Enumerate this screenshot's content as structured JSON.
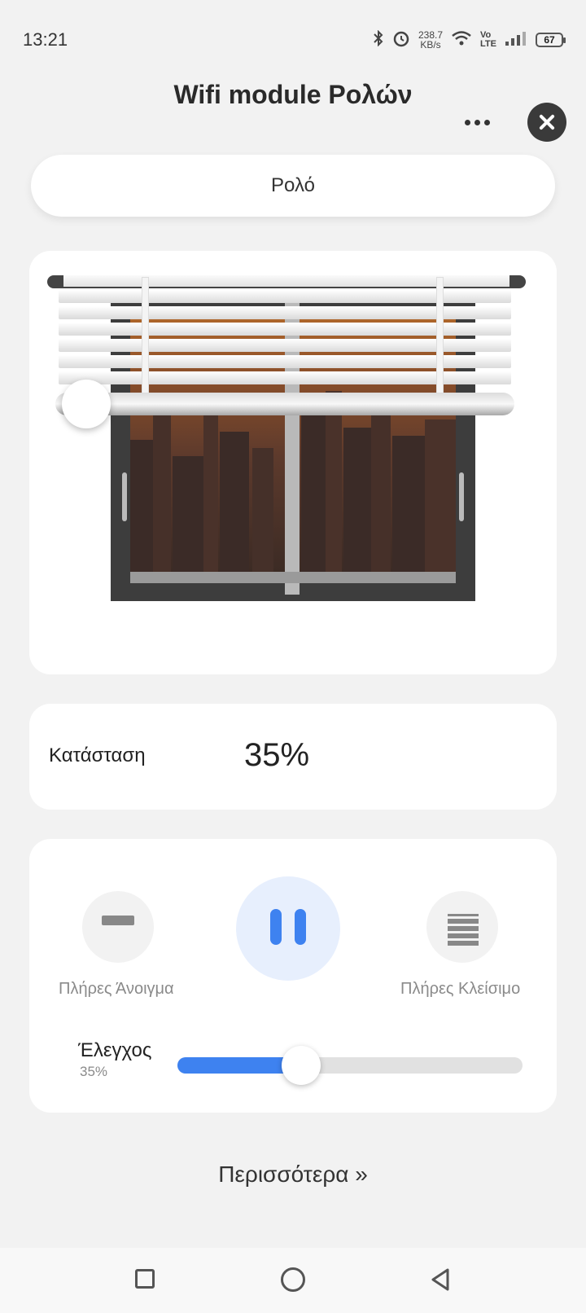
{
  "status_bar": {
    "time": "13:21",
    "net_speed_value": "238.7",
    "net_speed_unit": "KB/s",
    "volte_top": "Vo",
    "volte_bottom": "LTE",
    "battery": "67",
    "icons": [
      "bluetooth-icon",
      "alarm-icon",
      "wifi-icon",
      "signal-icon",
      "battery-icon"
    ]
  },
  "header": {
    "title": "Wifi module Ρολών"
  },
  "device": {
    "name": "Ρολό"
  },
  "state": {
    "label": "Κατάσταση",
    "value": "35%"
  },
  "controls": {
    "open_label": "Πλήρες Άνοιγμα",
    "close_label": "Πλήρες Κλείσιμο",
    "slider_title": "Έλεγχος",
    "slider_value": "35%",
    "slider_level": 0.35
  },
  "more_link": "Περισσότερα",
  "colors": {
    "accent": "#3e82f0",
    "background": "#f2f2f2",
    "card": "#ffffff"
  }
}
